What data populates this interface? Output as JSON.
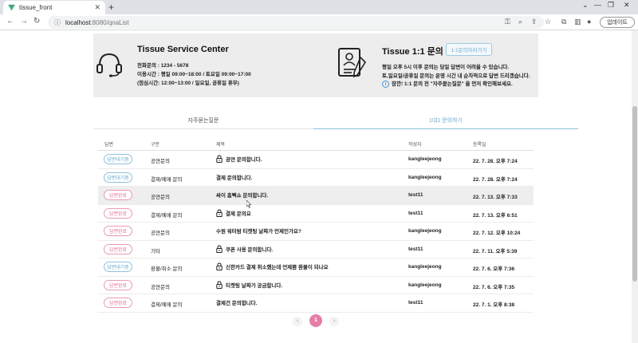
{
  "browser": {
    "tab_title": "tissue_front",
    "new_tab": "+",
    "url_host": "localhost",
    "url_rest": ":8080/qnaList",
    "update_label": "업데이트"
  },
  "service_center": {
    "title": "Tissue Service Center",
    "phone": "전화문의 : 1234 - 5678",
    "hours": "이용시간 : 평일 09:00~18:00 / 토요일 09:00~17:00",
    "lunch": "(점심시간: 12:00~13:00 / 일요일, 공휴일 휴무)"
  },
  "qa_info": {
    "title": "Tissue 1:1 문의",
    "goto_button": "1:1문의하러가기",
    "line1": "평일 오후 5시 이후 문의는 당일 답변이 어려울 수 있습니다.",
    "line2": "토,일요일/공휴일 문의는 운영 시간 내 순차적으로 답변 드리겠습니다.",
    "notice": "잠깐! 1:1 문의 전 \"자주묻는질문\" 을 먼저 확인해보세요."
  },
  "tabs": {
    "faq": "자주묻는질문",
    "qna": "1대1 문의하기"
  },
  "table": {
    "headers": {
      "status": "답변",
      "category": "구분",
      "title": "제목",
      "author": "작성자",
      "date": "등록일"
    },
    "rows": [
      {
        "status": "답변대기중",
        "status_type": "waiting",
        "category": "공연문의",
        "locked": true,
        "title": "공연 문의합니다.",
        "author": "kangleejeong",
        "date": "22. 7. 28. 오후 7:24"
      },
      {
        "status": "답변대기중",
        "status_type": "waiting",
        "category": "결제/예매 문의",
        "locked": false,
        "title": "결제 문의합니다.",
        "author": "kangleejeong",
        "date": "22. 7. 28. 오후 7:24"
      },
      {
        "status": "답변완료",
        "status_type": "done",
        "category": "공연문의",
        "locked": false,
        "title": "싸이 흠뻑쇼 문의합니다.",
        "author": "test11",
        "date": "22. 7. 13. 오후 7:33"
      },
      {
        "status": "답변완료",
        "status_type": "done",
        "category": "결제/예매 문의",
        "locked": true,
        "title": "결제 문의요",
        "author": "test11",
        "date": "22. 7. 13. 오후 6:51"
      },
      {
        "status": "답변완료",
        "status_type": "done",
        "category": "공연문의",
        "locked": false,
        "title": "수원 워터밤 티켓팅 날짜가 언제인가요?",
        "author": "kangleejeong",
        "date": "22. 7. 12. 오후 10:24"
      },
      {
        "status": "답변완료",
        "status_type": "done",
        "category": "기타",
        "locked": true,
        "title": "쿠폰 사용 문의합니다.",
        "author": "test11",
        "date": "22. 7. 11. 오후 5:39"
      },
      {
        "status": "답변대기중",
        "status_type": "waiting",
        "category": "환불/취소 문의",
        "locked": true,
        "title": "신한카드 결제 취소했는데 언제쯤 환불이 되나요",
        "author": "kangleejeong",
        "date": "22. 7. 6. 오후 7:36"
      },
      {
        "status": "답변완료",
        "status_type": "done",
        "category": "공연문의",
        "locked": true,
        "title": "티켓팅 날짜가 궁금합니다.",
        "author": "kangleejeong",
        "date": "22. 7. 6. 오후 7:35"
      },
      {
        "status": "답변완료",
        "status_type": "done",
        "category": "결제/예매 문의",
        "locked": false,
        "title": "결제건 문의합니다.",
        "author": "test11",
        "date": "22. 7. 1. 오후 8:38"
      }
    ]
  },
  "pagination": {
    "prev": "‹",
    "current": "1",
    "next": "›"
  },
  "colors": {
    "accent_blue": "#6aa9cf",
    "accent_pink": "#e57fa7"
  }
}
